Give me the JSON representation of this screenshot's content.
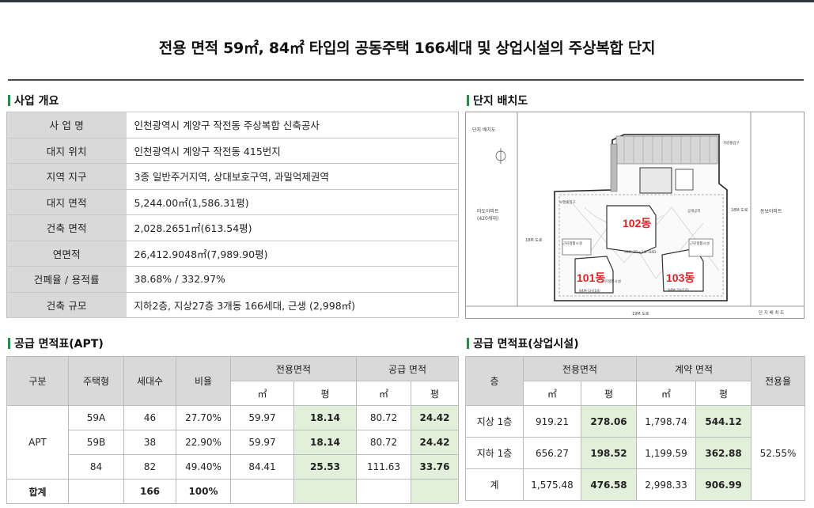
{
  "title": "전용 면적 59㎡, 84㎡ 타입의 공동주택 166세대 및 상업시설의 주상복합 단지",
  "sections": {
    "overview": "사업 개요",
    "site_plan": "단지 배치도",
    "supply_apt": "공급 면적표(APT)",
    "supply_com": "공급 면적표(상업시설)"
  },
  "overview_rows": [
    {
      "label": "사 업 명",
      "value": "인천광역시 계양구 작전동 주상복합 신축공사"
    },
    {
      "label": "대지 위치",
      "value": "인천광역시 계양구 작전동 415번지"
    },
    {
      "label": "지역 지구",
      "value": "3종 일반주거지역, 상대보호구역, 과밀억제권역"
    },
    {
      "label": "대지 면적",
      "value": "5,244.00㎡(1,586.31평)"
    },
    {
      "label": "건축 면적",
      "value": "2,028.2651㎡(613.54평)"
    },
    {
      "label": "연면적",
      "value": "26,412.9048㎡(7,989.90평)"
    },
    {
      "label": "건폐율 / 용적률",
      "value": "38.68% / 332.97%"
    },
    {
      "label": "건축 규모",
      "value": "지하2층, 지상27층 3개동 166세대,  근생 (2,998㎡)"
    }
  ],
  "site_plan": {
    "building_labels": [
      "101동",
      "102동",
      "103동"
    ],
    "caption": "단지 배치도",
    "legend": "단 지 배 치 도",
    "road_labels": [
      "18M 도로",
      "19M 도로",
      "18M 도로"
    ],
    "neighbors": [
      "미도아파트",
      "(420세대)",
      "동보아파트"
    ],
    "small_labels": [
      "근린생활시설",
      "근린생활시설",
      "근린생활시설",
      "84M-1H(18)",
      "84M-2H(18)",
      "59M-2D+24F-84D",
      "보행출입구",
      "차량출입구",
      "공개공지"
    ]
  },
  "apt_table": {
    "headers": {
      "col1": "구분",
      "col2": "주택형",
      "col3": "세대수",
      "col4": "비율",
      "excl": "전용면적",
      "supply": "공급 면적",
      "m2": "㎡",
      "py": "평"
    },
    "group": "APT",
    "rows": [
      {
        "type": "59A",
        "units": "46",
        "ratio": "27.70%",
        "excl_m2": "59.97",
        "excl_py": "18.14",
        "sup_m2": "80.72",
        "sup_py": "24.42"
      },
      {
        "type": "59B",
        "units": "38",
        "ratio": "22.90%",
        "excl_m2": "59.97",
        "excl_py": "18.14",
        "sup_m2": "80.72",
        "sup_py": "24.42"
      },
      {
        "type": "84",
        "units": "82",
        "ratio": "49.40%",
        "excl_m2": "84.41",
        "excl_py": "25.53",
        "sup_m2": "111.63",
        "sup_py": "33.76"
      }
    ],
    "total": {
      "label": "합계",
      "units": "166",
      "ratio": "100%"
    }
  },
  "com_table": {
    "headers": {
      "floor": "층",
      "excl": "전용면적",
      "contract": "계약 면적",
      "rate": "전용율",
      "m2": "㎡",
      "py": "평"
    },
    "rows": [
      {
        "floor": "지상 1층",
        "excl_m2": "919.21",
        "excl_py": "278.06",
        "con_m2": "1,798.74",
        "con_py": "544.12"
      },
      {
        "floor": "지하 1층",
        "excl_m2": "656.27",
        "excl_py": "198.52",
        "con_m2": "1,199.59",
        "con_py": "362.88"
      },
      {
        "floor": "계",
        "excl_m2": "1,575.48",
        "excl_py": "476.58",
        "con_m2": "2,998.33",
        "con_py": "906.99"
      }
    ],
    "rate_value": "52.55%"
  },
  "colors": {
    "accent_bar": "#2c8a4a",
    "header_bg": "#d9d9d9",
    "highlight_bg": "#e2efda",
    "building_label": "#e02020"
  }
}
